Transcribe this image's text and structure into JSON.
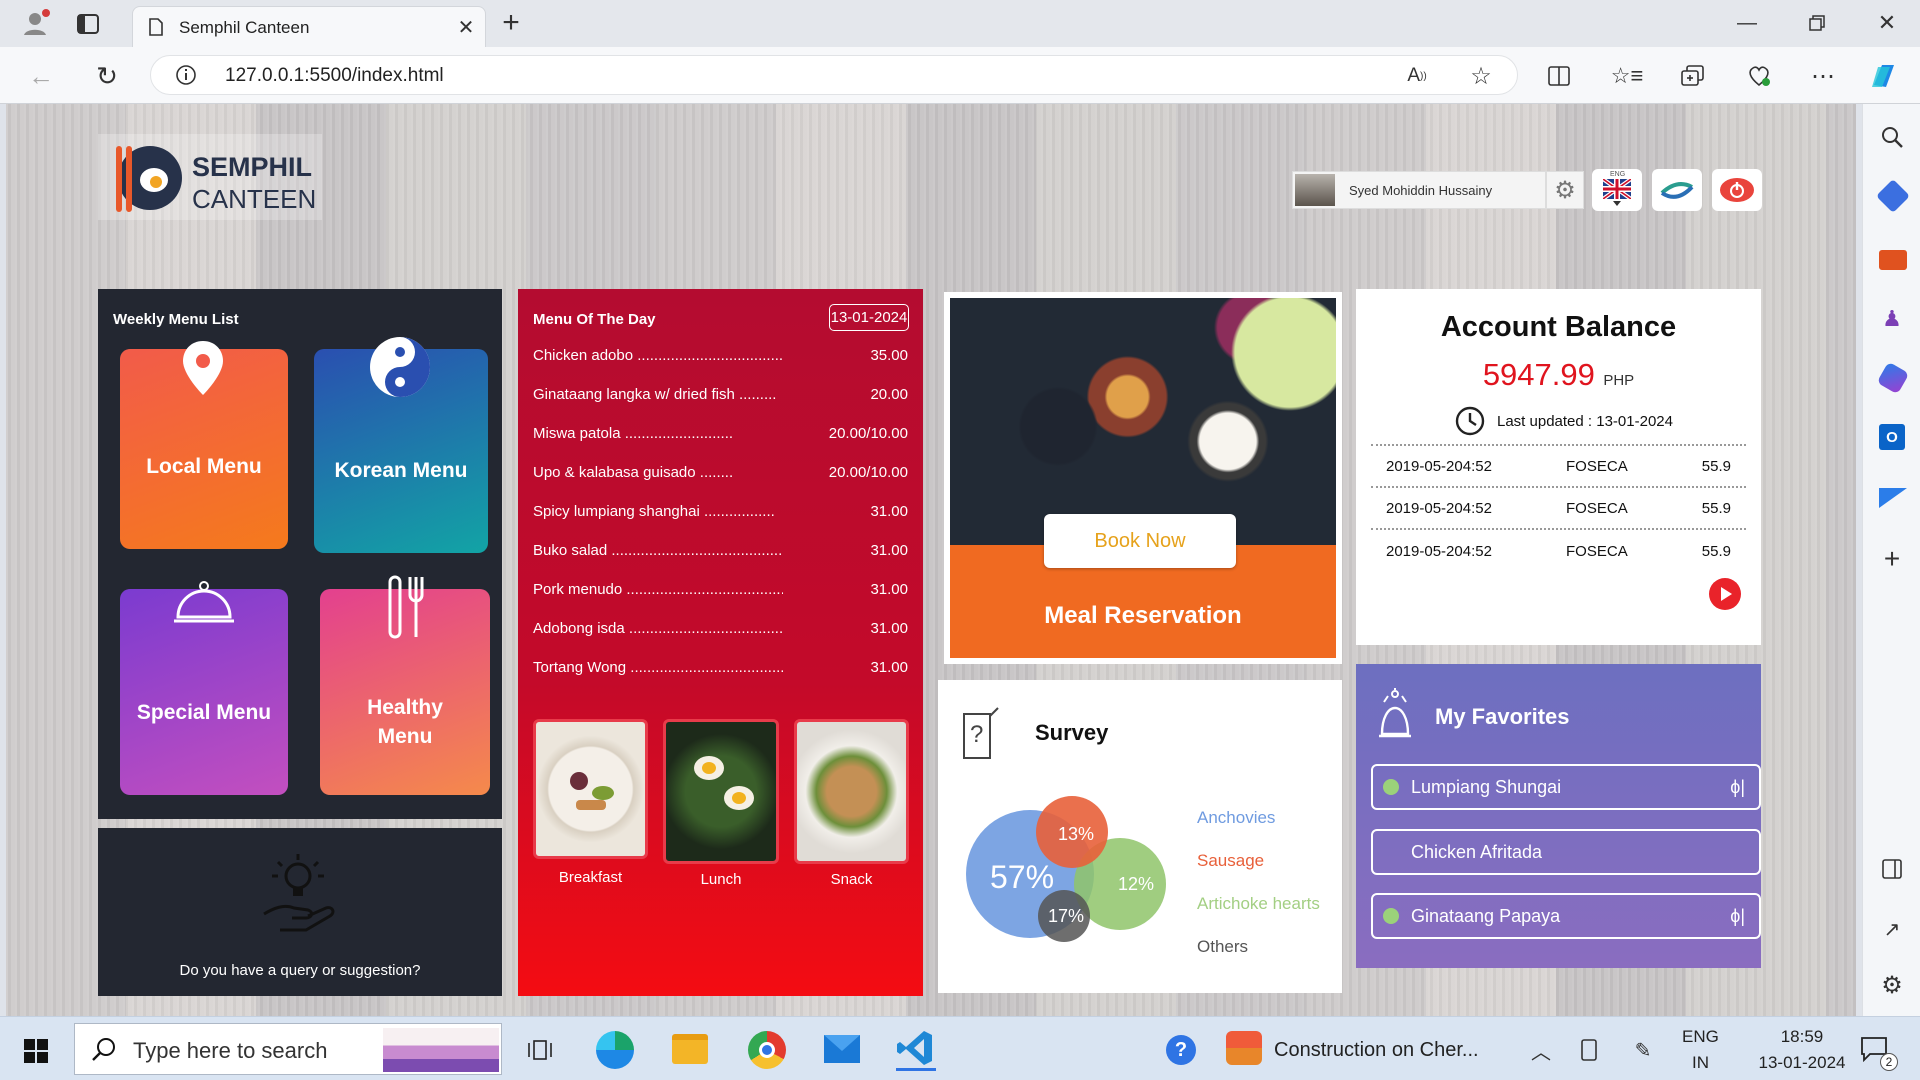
{
  "browser": {
    "tab_title": "Semphil Canteen",
    "url": "127.0.0.1:5500/index.html"
  },
  "header": {
    "logo_line1": "SEMPHIL",
    "logo_line2": "CANTEEN",
    "user_name": "Syed Mohiddin Hussainy",
    "lang_flag_label": "ENG"
  },
  "weekly_menu": {
    "title": "Weekly Menu List",
    "tiles": [
      {
        "label": "Local Menu",
        "icon": "location-pin-icon"
      },
      {
        "label": "Korean Menu",
        "icon": "yin-yang-icon"
      },
      {
        "label": "Special Menu",
        "icon": "cloche-icon"
      },
      {
        "label": "Healthy Menu",
        "icon": "fork-knife-icon"
      }
    ]
  },
  "query_panel": {
    "text": "Do you have a query or suggestion?"
  },
  "menu_of_day": {
    "title": "Menu Of The Day",
    "date": "13-01-2024",
    "items": [
      {
        "name": "Chicken adobo .......................................",
        "price": "35.00"
      },
      {
        "name": "Ginataang langka w/ dried fish .........",
        "price": "20.00"
      },
      {
        "name": "Miswa patola ..........................",
        "price": "20.00/10.00"
      },
      {
        "name": "Upo & kalabasa guisado ........",
        "price": "20.00/10.00"
      },
      {
        "name": "Spicy lumpiang shanghai .................",
        "price": "31.00"
      },
      {
        "name": "Buko salad ..........................................",
        "price": "31.00"
      },
      {
        "name": "Pork menudo ......................................",
        "price": "31.00"
      },
      {
        "name": "Adobong isda .....................................",
        "price": "31.00"
      },
      {
        "name": "Tortang Wong .....................................",
        "price": "31.00"
      }
    ],
    "meals": [
      "Breakfast",
      "Lunch",
      "Snack"
    ]
  },
  "reservation": {
    "button": "Book Now",
    "caption": "Meal Reservation"
  },
  "account": {
    "title": "Account Balance",
    "amount": "5947.99",
    "currency": "PHP",
    "last_updated": "Last updated : 13-01-2024",
    "transactions": [
      {
        "date": "2019-05-204:52",
        "store": "FOSECA",
        "amount": "55.9"
      },
      {
        "date": "2019-05-204:52",
        "store": "FOSECA",
        "amount": "55.9"
      },
      {
        "date": "2019-05-204:52",
        "store": "FOSECA",
        "amount": "55.9"
      }
    ]
  },
  "survey": {
    "title": "Survey",
    "slices": [
      {
        "label": "57%",
        "legend": "Anchovies",
        "color": "#6f9be0"
      },
      {
        "label": "13%",
        "legend": "Sausage",
        "color": "#e8603a"
      },
      {
        "label": "12%",
        "legend": "Artichoke hearts",
        "color": "#8fc46a"
      },
      {
        "label": "17%",
        "legend": "Others",
        "color": "#555555"
      }
    ]
  },
  "favorites": {
    "title": "My Favorites",
    "items": [
      {
        "name": "Lumpiang Shungai",
        "dot": true
      },
      {
        "name": "Chicken Afritada",
        "dot": false
      },
      {
        "name": "Ginataang Papaya",
        "dot": true
      }
    ]
  },
  "taskbar": {
    "search_placeholder": "Type here to search",
    "news": "Construction on Cher...",
    "lang": "ENG",
    "region": "IN",
    "time": "18:59",
    "date": "13-01-2024",
    "notif_count": "2"
  },
  "colors": {
    "menu_red": "#c8102e",
    "fav_purple": "#7b6bbb",
    "balance_red": "#e0141e"
  }
}
